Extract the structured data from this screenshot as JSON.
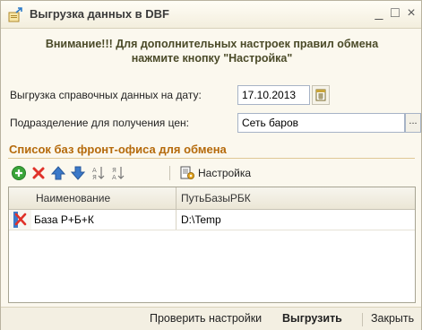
{
  "window": {
    "title": "Выгрузка данных в DBF",
    "controls": {
      "minimize": "_",
      "maximize": "□",
      "close": "×"
    }
  },
  "warning": {
    "line1": "Внимание!!! Для дополнительных настроек правил обмена",
    "line2": "нажмите кнопку \"Настройка\""
  },
  "form": {
    "date_label": "Выгрузка справочных данных на дату:",
    "date_value": "17.10.2013",
    "subdivision_label": "Подразделение для получения цен:",
    "subdivision_value": "Сеть баров",
    "select_button": "..."
  },
  "section": {
    "title": "Список баз фронт-офиса для обмена"
  },
  "toolbar": {
    "settings_label": "Настройка",
    "icons": [
      "add-icon",
      "delete-icon",
      "move-up-icon",
      "move-down-icon",
      "sort-ascending-icon",
      "sort-descending-icon",
      "settings-icon"
    ]
  },
  "table": {
    "columns": [
      "Наименование",
      "ПутьБазыРБК"
    ],
    "rows": [
      {
        "name": "База Р+Б+К",
        "path": "D:\\Temp"
      }
    ]
  },
  "footer": {
    "check_settings": "Проверить настройки",
    "export": "Выгрузить",
    "close": "Закрыть"
  },
  "colors": {
    "section_title": "#b56a0b",
    "add_icon": "#3aa53a",
    "delete_icon": "#e0322a",
    "arrow_icon": "#3b79c9"
  }
}
